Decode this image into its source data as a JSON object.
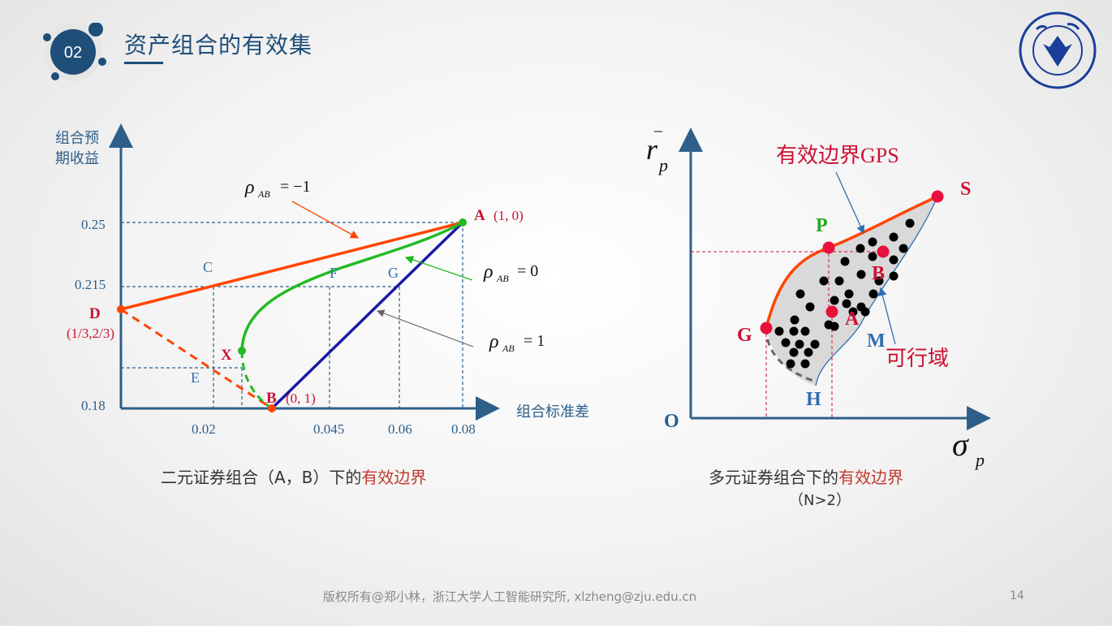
{
  "header": {
    "badge": "02",
    "title": "资产组合的有效集"
  },
  "left_chart": {
    "ylabel_line1": "组合预",
    "ylabel_line2": "期收益",
    "xlabel": "组合标准差",
    "y_ticks": [
      "0.25",
      "0.215",
      "0.18"
    ],
    "x_ticks": [
      "0.02",
      "0.045",
      "0.06",
      "0.08"
    ],
    "points": {
      "A": "A",
      "A_coord": "(1,  0)",
      "B": "B",
      "B_coord": "(0,  1)",
      "C": "C",
      "D": "D",
      "D_coord": "(1/3,2/3)",
      "E": "E",
      "F": "F",
      "G": "G",
      "X": "X"
    },
    "rho_labels": {
      "rho": "ρ",
      "sub": "AB",
      "neg1": "= −1",
      "zero": "= 0",
      "one": "= 1"
    },
    "colors": {
      "rho_neg1": "#ff4500",
      "rho_zero": "#22bb22",
      "rho_one": "#1a1aa6",
      "axis": "#2e5f8a",
      "dashed": "#2e5f8a"
    }
  },
  "right_chart": {
    "ylabel": "r",
    "ylabel_sub": "p",
    "ylabel_bar": "_",
    "xlabel": "σ",
    "xlabel_sub": "p",
    "origin": "O",
    "frontier_label": "有效边界GPS",
    "feasible_label": "可行域",
    "points": {
      "P": "P",
      "S": "S",
      "G": "G",
      "B": "B",
      "A": "A",
      "M": "M",
      "H": "H"
    }
  },
  "captions": {
    "left_prefix": "二元证券组合（A，B）下的",
    "left_highlight": "有效边界",
    "right_prefix": "多元证券组合下的",
    "right_highlight": "有效边界",
    "right_sub": "（N>2）"
  },
  "footer": {
    "text": "版权所有@郑小林，浙江大学人工智能研究所, xlzheng@zju.edu.cn",
    "page": "14"
  }
}
